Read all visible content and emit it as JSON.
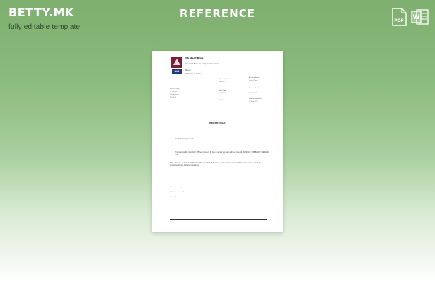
{
  "brand": {
    "logo": "BETTY.MK",
    "tagline": "fully editable template"
  },
  "header": {
    "title": "REFERENCE"
  },
  "formats": {
    "pdf_label": "PDF",
    "word_label": "W"
  },
  "document": {
    "logo_text": "AIB",
    "product_title": "Student Plus",
    "bank_lines": [
      "Allied Irish Banks plc Incorporated in Ireland",
      "Branch",
      "Dublin Street, Dublin 2"
    ],
    "customer_address": [
      "John O'Brien",
      "2 Flat 2B",
      "Sandymount",
      "DUBLIN"
    ],
    "mid_fields": [
      {
        "label": "Date of Certificate",
        "value": "01.04.17"
      },
      {
        "label": "Sort Code",
        "value": "93-XX-XX"
      },
      {
        "label": "Registration",
        "value": ""
      }
    ],
    "right_fields": [
      {
        "label": "Account Name",
        "value": "John O'Brien"
      },
      {
        "label": "Account Number",
        "value": "44XXXXXX"
      },
      {
        "label": "Date of Reference",
        "value": "14 Nov 2012"
      }
    ],
    "heading": "REFERENCE",
    "salutation": "To whom it may concern",
    "paragraph1_pre": "This is to confirm that ",
    "paragraph1_name": "John O'Brien",
    "paragraph1_mid": " (account #) has a current account with us since ",
    "paragraph1_date": "12.09.2012",
    "paragraph1_post": " in \"AIB BANK\" IRELAND LTD.",
    "paragraph2": "The reference is provided without liability on behalf of the bank, and is given in strict confidence at the request of our customer for the purpose requested.",
    "closing_lines": [
      "Yours sincerely,",
      "Chief Executive Officer",
      "Jack Byrne"
    ]
  }
}
